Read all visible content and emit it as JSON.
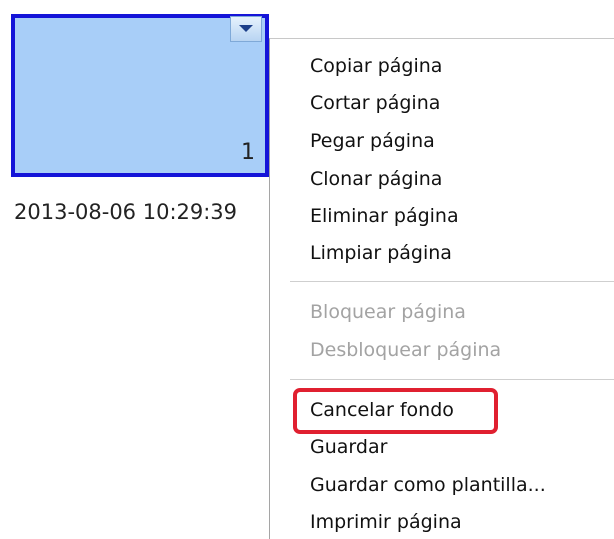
{
  "thumbnail": {
    "page_number": "1",
    "timestamp": "2013-08-06 10:29:39",
    "dropdown_icon": "triangle-down"
  },
  "menu": {
    "items": [
      {
        "label": "Copiar página",
        "enabled": true
      },
      {
        "label": "Cortar página",
        "enabled": true
      },
      {
        "label": "Pegar página",
        "enabled": true
      },
      {
        "label": "Clonar página",
        "enabled": true
      },
      {
        "label": "Eliminar página",
        "enabled": true
      },
      {
        "label": "Limpiar página",
        "enabled": true
      },
      {
        "label": "Bloquear página",
        "enabled": false
      },
      {
        "label": "Desbloquear página",
        "enabled": false
      },
      {
        "label": "Cancelar fondo",
        "enabled": true,
        "highlighted": true
      },
      {
        "label": "Guardar",
        "enabled": true
      },
      {
        "label": "Guardar como plantilla...",
        "enabled": true
      },
      {
        "label": "Imprimir página",
        "enabled": true
      }
    ]
  },
  "colors": {
    "thumbnail_fill": "#a8cef8",
    "thumbnail_border": "#1414d8",
    "highlight_border": "#e02030",
    "disabled_text": "#a3a3a3"
  }
}
